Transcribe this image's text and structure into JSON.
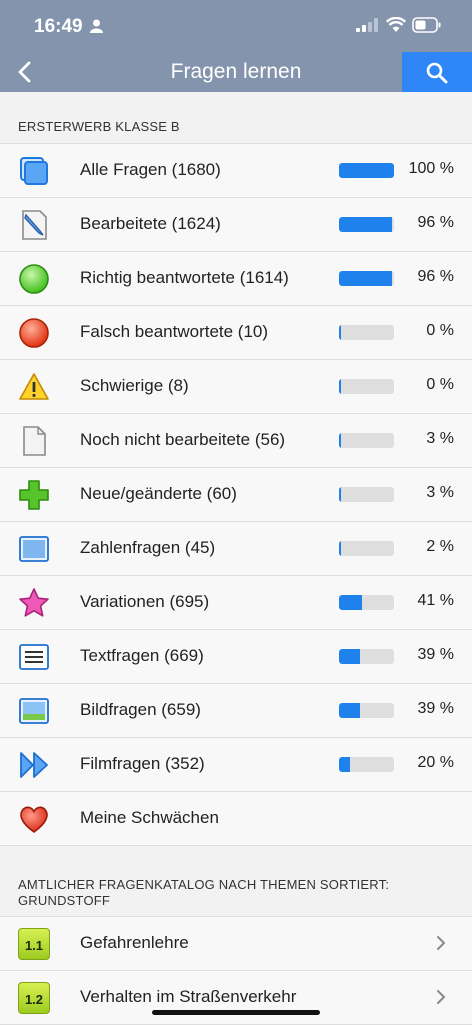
{
  "status_bar": {
    "time": "16:49"
  },
  "nav": {
    "title": "Fragen lernen"
  },
  "sections": {
    "main_header": "ERSTERWERB KLASSE B",
    "catalog_header": "AMTLICHER FRAGENKATALOG NACH THEMEN SORTIERT: GRUNDSTOFF"
  },
  "items": [
    {
      "label": "Alle Fragen (1680)",
      "percent_text": "100 %",
      "progress": 1.0,
      "icon": "stacked-squares-icon"
    },
    {
      "label": "Bearbeitete (1624)",
      "percent_text": "96 %",
      "progress": 0.96,
      "icon": "edit-document-icon"
    },
    {
      "label": "Richtig beantwortete (1614)",
      "percent_text": "96 %",
      "progress": 0.96,
      "icon": "green-circle-icon"
    },
    {
      "label": "Falsch beantwortete (10)",
      "percent_text": "0 %",
      "progress": 0.0,
      "icon": "red-circle-icon"
    },
    {
      "label": "Schwierige (8)",
      "percent_text": "0 %",
      "progress": 0.0,
      "icon": "warning-icon"
    },
    {
      "label": "Noch nicht bearbeitete (56)",
      "percent_text": "3 %",
      "progress": 0.03,
      "icon": "blank-document-icon"
    },
    {
      "label": "Neue/geänderte (60)",
      "percent_text": "3 %",
      "progress": 0.03,
      "icon": "green-plus-icon"
    },
    {
      "label": "Zahlenfragen (45)",
      "percent_text": "2 %",
      "progress": 0.02,
      "icon": "number-frame-icon"
    },
    {
      "label": "Variationen (695)",
      "percent_text": "41 %",
      "progress": 0.41,
      "icon": "pink-star-icon"
    },
    {
      "label": "Textfragen (669)",
      "percent_text": "39 %",
      "progress": 0.39,
      "icon": "text-lines-icon"
    },
    {
      "label": "Bildfragen (659)",
      "percent_text": "39 %",
      "progress": 0.39,
      "icon": "picture-icon"
    },
    {
      "label": "Filmfragen (352)",
      "percent_text": "20 %",
      "progress": 0.2,
      "icon": "fast-forward-icon"
    },
    {
      "label": "Meine Schwächen",
      "icon": "heart-icon"
    }
  ],
  "catalog": [
    {
      "badge": "1.1",
      "label": "Gefahrenlehre"
    },
    {
      "badge": "1.2",
      "label": "Verhalten im Straßenverkehr"
    }
  ],
  "colors": {
    "header_bg": "#8594ad",
    "accent": "#2f86f6",
    "progress": "#1f82ec"
  }
}
